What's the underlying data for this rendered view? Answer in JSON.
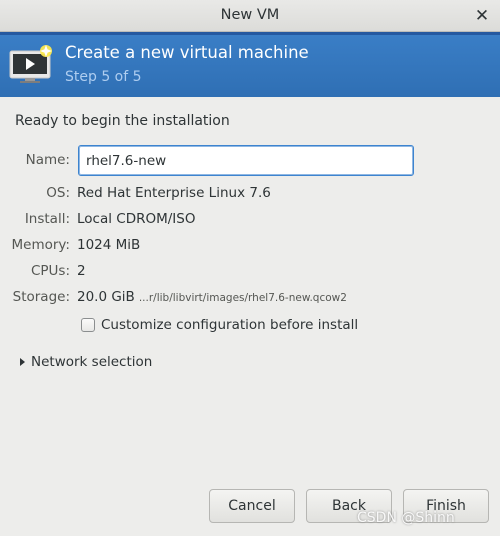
{
  "window": {
    "title": "New VM",
    "close_glyph": "✕"
  },
  "header": {
    "title": "Create a new virtual machine",
    "subtitle": "Step 5 of 5",
    "icon": "vm-monitor-icon",
    "accent": "#3a7ec6"
  },
  "summary": {
    "heading": "Ready to begin the installation",
    "name_label": "Name:",
    "name_value": "rhel7.6-new",
    "os_label": "OS:",
    "os_value": "Red Hat Enterprise Linux 7.6",
    "install_label": "Install:",
    "install_value": "Local CDROM/ISO",
    "memory_label": "Memory:",
    "memory_value": "1024 MiB",
    "cpus_label": "CPUs:",
    "cpus_value": "2",
    "storage_label": "Storage:",
    "storage_value": "20.0 GiB",
    "storage_path": "...r/lib/libvirt/images/rhel7.6-new.qcow2"
  },
  "options": {
    "customize_label": "Customize configuration before install",
    "customize_checked": false,
    "network_label": "Network selection"
  },
  "buttons": {
    "cancel": "Cancel",
    "back": "Back",
    "finish": "Finish"
  },
  "watermark": "CSDN @Shinn"
}
